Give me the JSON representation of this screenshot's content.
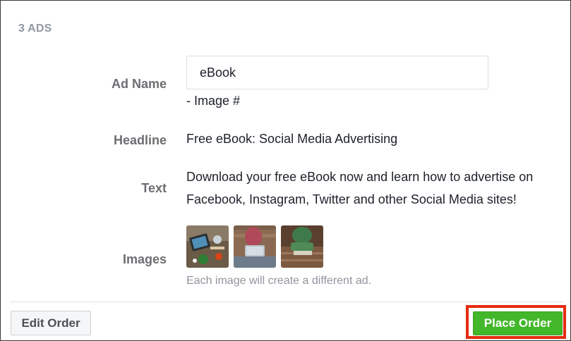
{
  "section": {
    "title": "3 ADS"
  },
  "fields": {
    "ad_name": {
      "label": "Ad Name",
      "value": "eBook",
      "suffix": "- Image #"
    },
    "headline": {
      "label": "Headline",
      "value": "Free eBook: Social Media Advertising"
    },
    "text": {
      "label": "Text",
      "value": "Download your free eBook now and learn how to advertise on Facebook, Instagram, Twitter and other Social Media sites!"
    },
    "images": {
      "label": "Images",
      "thumbnails": [
        "image-1",
        "image-2",
        "image-3"
      ],
      "hint": "Each image will create a different ad."
    }
  },
  "footer": {
    "edit_label": "Edit Order",
    "place_label": "Place Order"
  },
  "colors": {
    "place_button": "#42b72a",
    "highlight": "#e62a10",
    "label_gray": "#6d6e71",
    "hint_gray": "#90949c"
  }
}
